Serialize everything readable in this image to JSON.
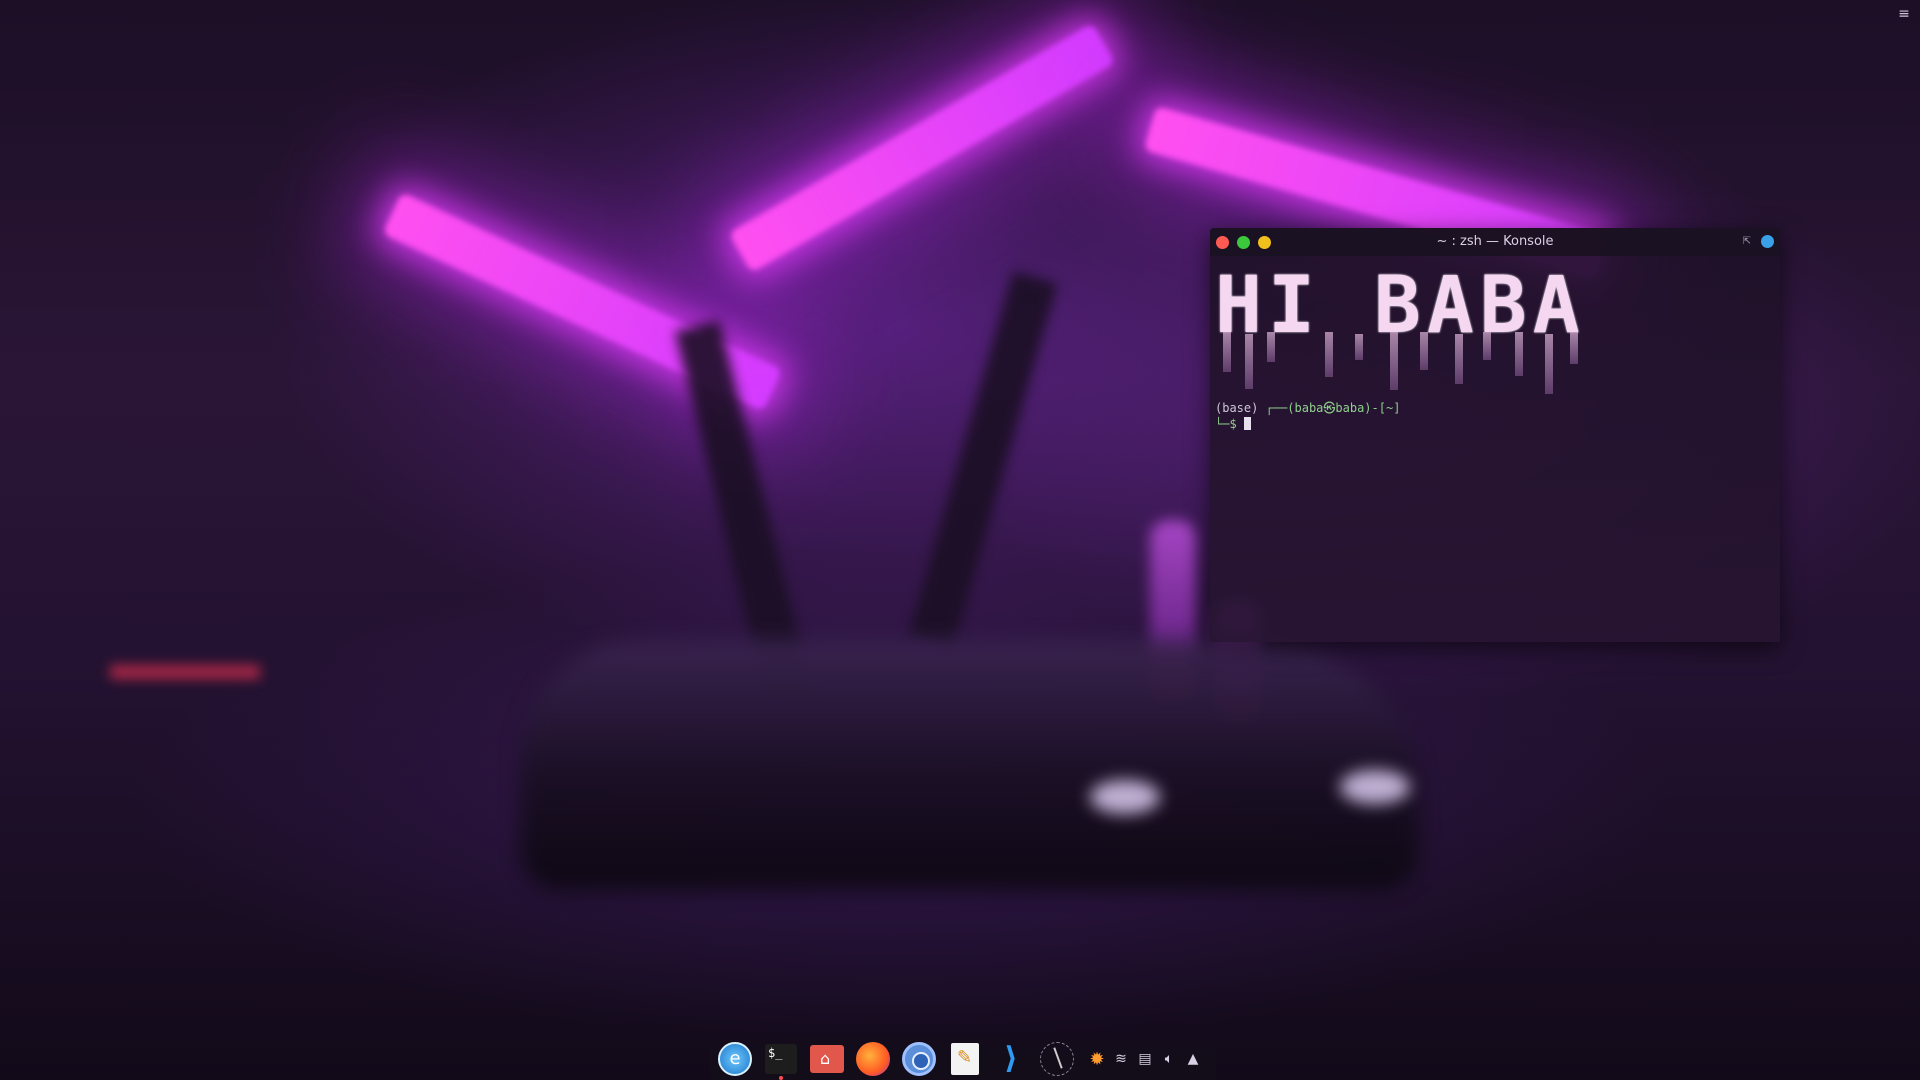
{
  "window": {
    "title": "~ : zsh — Konsole"
  },
  "terminal": {
    "banner": "HI BABA",
    "env": "(base)",
    "prompt_prefix": "┌──",
    "user_host": "(baba㉿baba)",
    "path": "-[~]",
    "prompt_second": "└─$"
  },
  "dock": {
    "apps": [
      "elementary-icon",
      "terminal-icon",
      "files-icon",
      "firefox-icon",
      "chromium-icon",
      "text-editor-icon",
      "vscode-icon",
      "clock-icon"
    ],
    "terminal_label": "$_"
  },
  "tray": {
    "icons": [
      "weather-sun-icon",
      "wifi-icon",
      "clipboard-icon",
      "volume-icon",
      "tray-expand-icon"
    ]
  },
  "colors": {
    "close": "#ff5a52",
    "minimize": "#3cc83c",
    "maximize": "#f2c01c",
    "neon": "#ff4ff0"
  }
}
